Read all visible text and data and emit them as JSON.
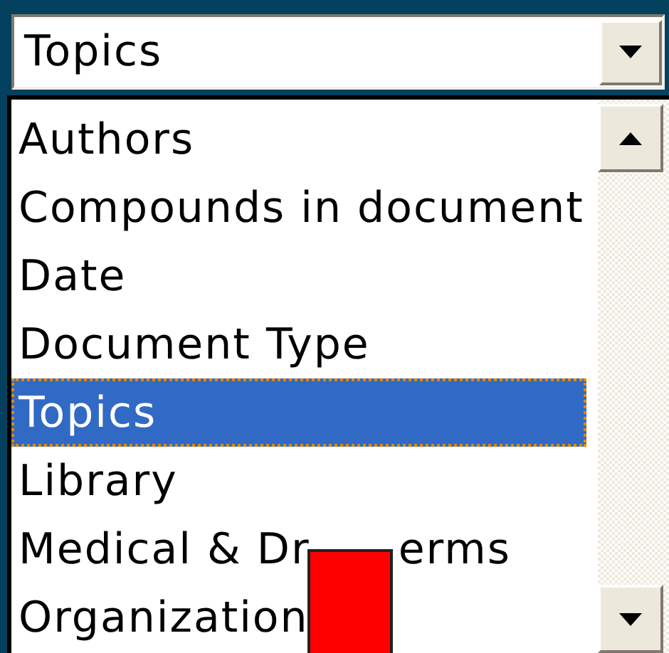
{
  "combobox": {
    "value": "Topics"
  },
  "list": {
    "items": [
      {
        "label": "Authors",
        "selected": false
      },
      {
        "label": "Compounds in document",
        "selected": false
      },
      {
        "label": "Date",
        "selected": false
      },
      {
        "label": "Document Type",
        "selected": false
      },
      {
        "label": "Topics",
        "selected": true
      },
      {
        "label": "Library",
        "selected": false
      },
      {
        "label": "Medical & Dr",
        "label_after": "erms",
        "selected": false
      },
      {
        "label": "Organization",
        "selected": false
      }
    ]
  }
}
